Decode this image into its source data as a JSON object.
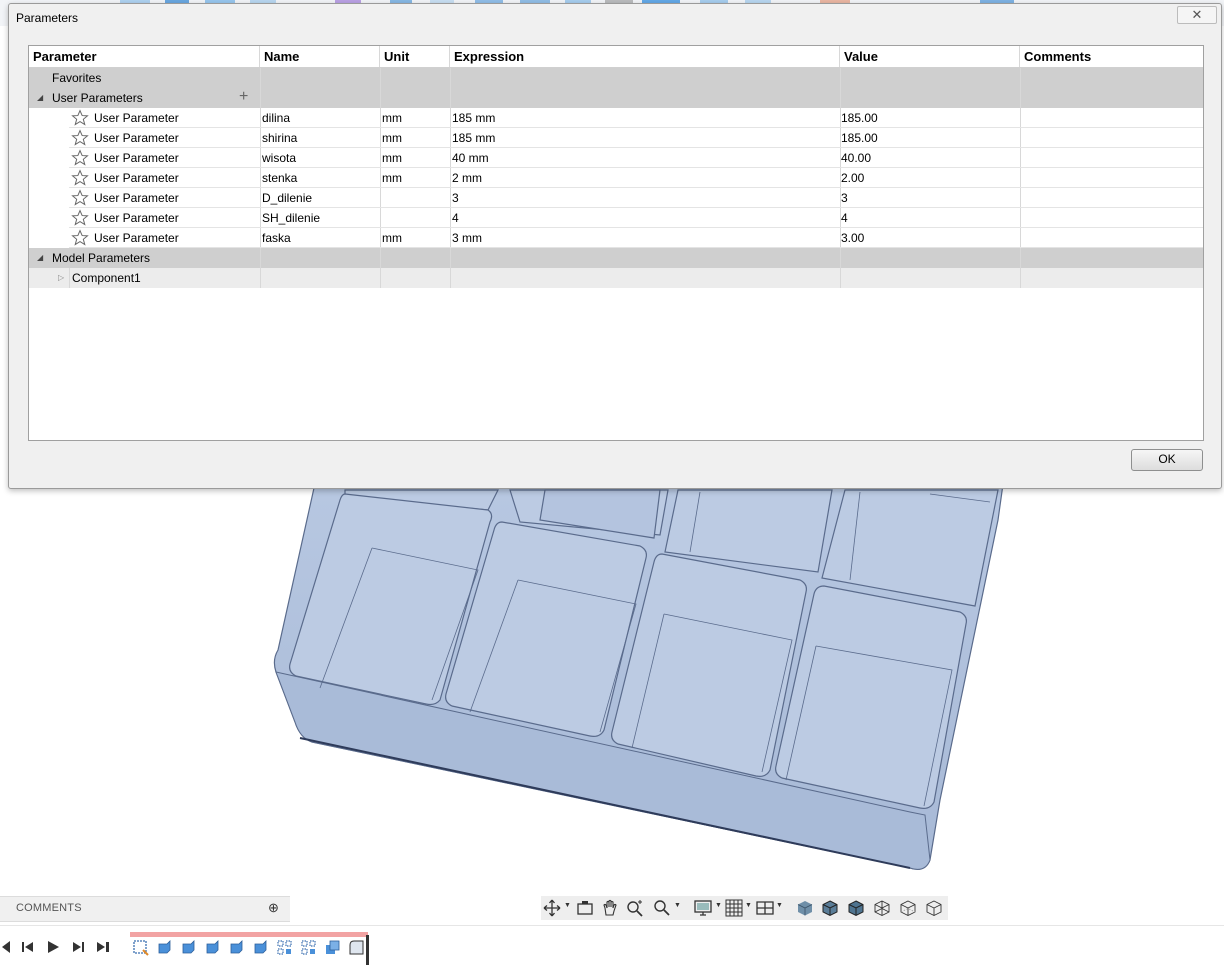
{
  "dialog": {
    "title": "Parameters",
    "close_label": "✕",
    "ok_label": "OK"
  },
  "table": {
    "columns": {
      "parameter": "Parameter",
      "name": "Name",
      "unit": "Unit",
      "expression": "Expression",
      "value": "Value",
      "comments": "Comments"
    },
    "favorites_label": "Favorites",
    "user_params_label": "User Parameters",
    "model_params_label": "Model Parameters",
    "component_label": "Component1",
    "user_params": [
      {
        "type": "User Parameter",
        "name": "dilina",
        "unit": "mm",
        "expression": "185 mm",
        "value": "185.00",
        "comments": ""
      },
      {
        "type": "User Parameter",
        "name": "shirina",
        "unit": "mm",
        "expression": "185 mm",
        "value": "185.00",
        "comments": ""
      },
      {
        "type": "User Parameter",
        "name": "wisota",
        "unit": "mm",
        "expression": "40 mm",
        "value": "40.00",
        "comments": ""
      },
      {
        "type": "User Parameter",
        "name": "stenka",
        "unit": "mm",
        "expression": "2 mm",
        "value": "2.00",
        "comments": ""
      },
      {
        "type": "User Parameter",
        "name": "D_dilenie",
        "unit": "",
        "expression": "3",
        "value": "3",
        "comments": ""
      },
      {
        "type": "User Parameter",
        "name": "SH_dilenie",
        "unit": "",
        "expression": "4",
        "value": "4",
        "comments": ""
      },
      {
        "type": "User Parameter",
        "name": "faska",
        "unit": "mm",
        "expression": "3 mm",
        "value": "3.00",
        "comments": ""
      }
    ]
  },
  "bottom": {
    "comments_label": "COMMENTS"
  },
  "colors": {
    "model_fill": "#b3c3dd",
    "model_edge": "#3d4b6b",
    "section_row": "#cfcfcf",
    "timeline_track": "#f2a3a3",
    "feature_icon": "#4a90d9"
  },
  "icons": {
    "favorite": "star-outline-icon",
    "expand": "triangle-icon",
    "add": "plus-icon"
  }
}
